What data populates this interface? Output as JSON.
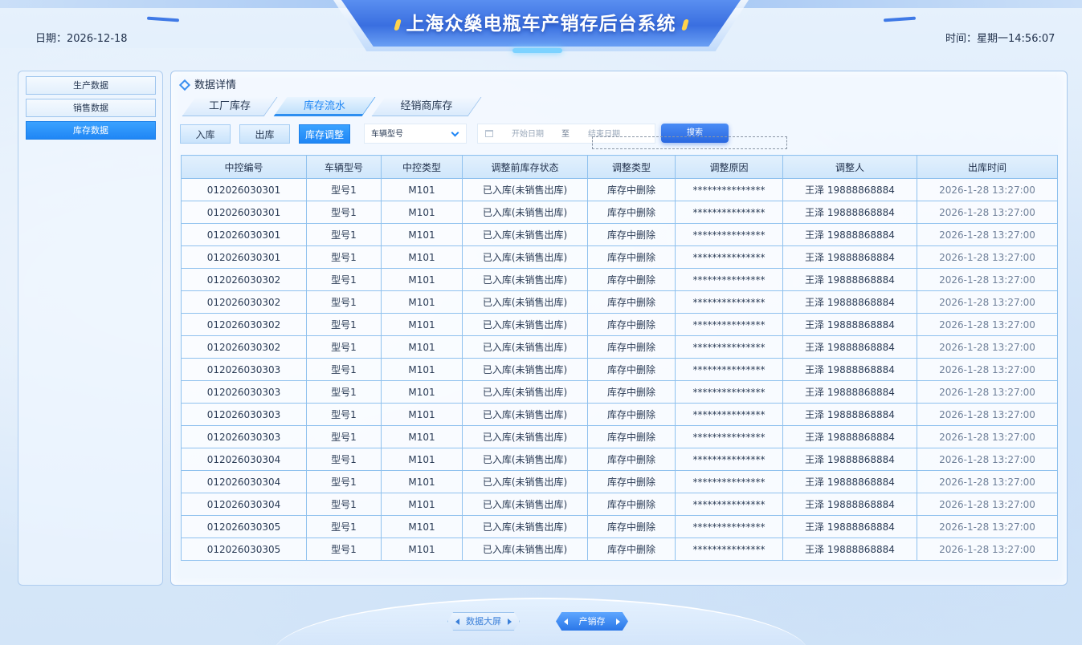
{
  "header": {
    "title": "上海众燊电瓶车产销存后台系统",
    "date": "日期：2026-12-18",
    "time": "时间：星期一14:56:07"
  },
  "sidebar": {
    "items": [
      {
        "label": "生产数据",
        "active": false
      },
      {
        "label": "销售数据",
        "active": false
      },
      {
        "label": "库存数据",
        "active": true
      }
    ]
  },
  "panel": {
    "title": "数据详情",
    "tabs": [
      {
        "label": "工厂库存",
        "active": false
      },
      {
        "label": "库存流水",
        "active": true
      },
      {
        "label": "经销商库存",
        "active": false
      }
    ],
    "buttons": [
      {
        "label": "入库",
        "active": false
      },
      {
        "label": "出库",
        "active": false
      },
      {
        "label": "库存调整",
        "active": true
      }
    ],
    "model_select": "车辆型号",
    "start_date_placeholder": "开始日期",
    "range_separator": "至",
    "end_date_placeholder": "结束日期",
    "search_label": "搜索"
  },
  "table": {
    "columns": [
      "中控编号",
      "车辆型号",
      "中控类型",
      "调整前库存状态",
      "调整类型",
      "调整原因",
      "调整人",
      "出库时间"
    ],
    "rows": [
      [
        "012026030301",
        "型号1",
        "M101",
        "已入库(未销售出库)",
        "库存中删除",
        "***************",
        "王泽 19888868884",
        "2026-1-28  13:27:00"
      ],
      [
        "012026030301",
        "型号1",
        "M101",
        "已入库(未销售出库)",
        "库存中删除",
        "***************",
        "王泽 19888868884",
        "2026-1-28  13:27:00"
      ],
      [
        "012026030301",
        "型号1",
        "M101",
        "已入库(未销售出库)",
        "库存中删除",
        "***************",
        "王泽 19888868884",
        "2026-1-28  13:27:00"
      ],
      [
        "012026030301",
        "型号1",
        "M101",
        "已入库(未销售出库)",
        "库存中删除",
        "***************",
        "王泽 19888868884",
        "2026-1-28  13:27:00"
      ],
      [
        "012026030302",
        "型号1",
        "M101",
        "已入库(未销售出库)",
        "库存中删除",
        "***************",
        "王泽 19888868884",
        "2026-1-28  13:27:00"
      ],
      [
        "012026030302",
        "型号1",
        "M101",
        "已入库(未销售出库)",
        "库存中删除",
        "***************",
        "王泽 19888868884",
        "2026-1-28  13:27:00"
      ],
      [
        "012026030302",
        "型号1",
        "M101",
        "已入库(未销售出库)",
        "库存中删除",
        "***************",
        "王泽 19888868884",
        "2026-1-28  13:27:00"
      ],
      [
        "012026030302",
        "型号1",
        "M101",
        "已入库(未销售出库)",
        "库存中删除",
        "***************",
        "王泽 19888868884",
        "2026-1-28  13:27:00"
      ],
      [
        "012026030303",
        "型号1",
        "M101",
        "已入库(未销售出库)",
        "库存中删除",
        "***************",
        "王泽 19888868884",
        "2026-1-28  13:27:00"
      ],
      [
        "012026030303",
        "型号1",
        "M101",
        "已入库(未销售出库)",
        "库存中删除",
        "***************",
        "王泽 19888868884",
        "2026-1-28  13:27:00"
      ],
      [
        "012026030303",
        "型号1",
        "M101",
        "已入库(未销售出库)",
        "库存中删除",
        "***************",
        "王泽 19888868884",
        "2026-1-28  13:27:00"
      ],
      [
        "012026030303",
        "型号1",
        "M101",
        "已入库(未销售出库)",
        "库存中删除",
        "***************",
        "王泽 19888868884",
        "2026-1-28  13:27:00"
      ],
      [
        "012026030304",
        "型号1",
        "M101",
        "已入库(未销售出库)",
        "库存中删除",
        "***************",
        "王泽 19888868884",
        "2026-1-28  13:27:00"
      ],
      [
        "012026030304",
        "型号1",
        "M101",
        "已入库(未销售出库)",
        "库存中删除",
        "***************",
        "王泽 19888868884",
        "2026-1-28  13:27:00"
      ],
      [
        "012026030304",
        "型号1",
        "M101",
        "已入库(未销售出库)",
        "库存中删除",
        "***************",
        "王泽 19888868884",
        "2026-1-28  13:27:00"
      ],
      [
        "012026030305",
        "型号1",
        "M101",
        "已入库(未销售出库)",
        "库存中删除",
        "***************",
        "王泽 19888868884",
        "2026-1-28  13:27:00"
      ],
      [
        "012026030305",
        "型号1",
        "M101",
        "已入库(未销售出库)",
        "库存中删除",
        "***************",
        "王泽 19888868884",
        "2026-1-28  13:27:00"
      ]
    ]
  },
  "footer": {
    "big_screen_label": "数据大屏",
    "sales_label": "产销存"
  }
}
